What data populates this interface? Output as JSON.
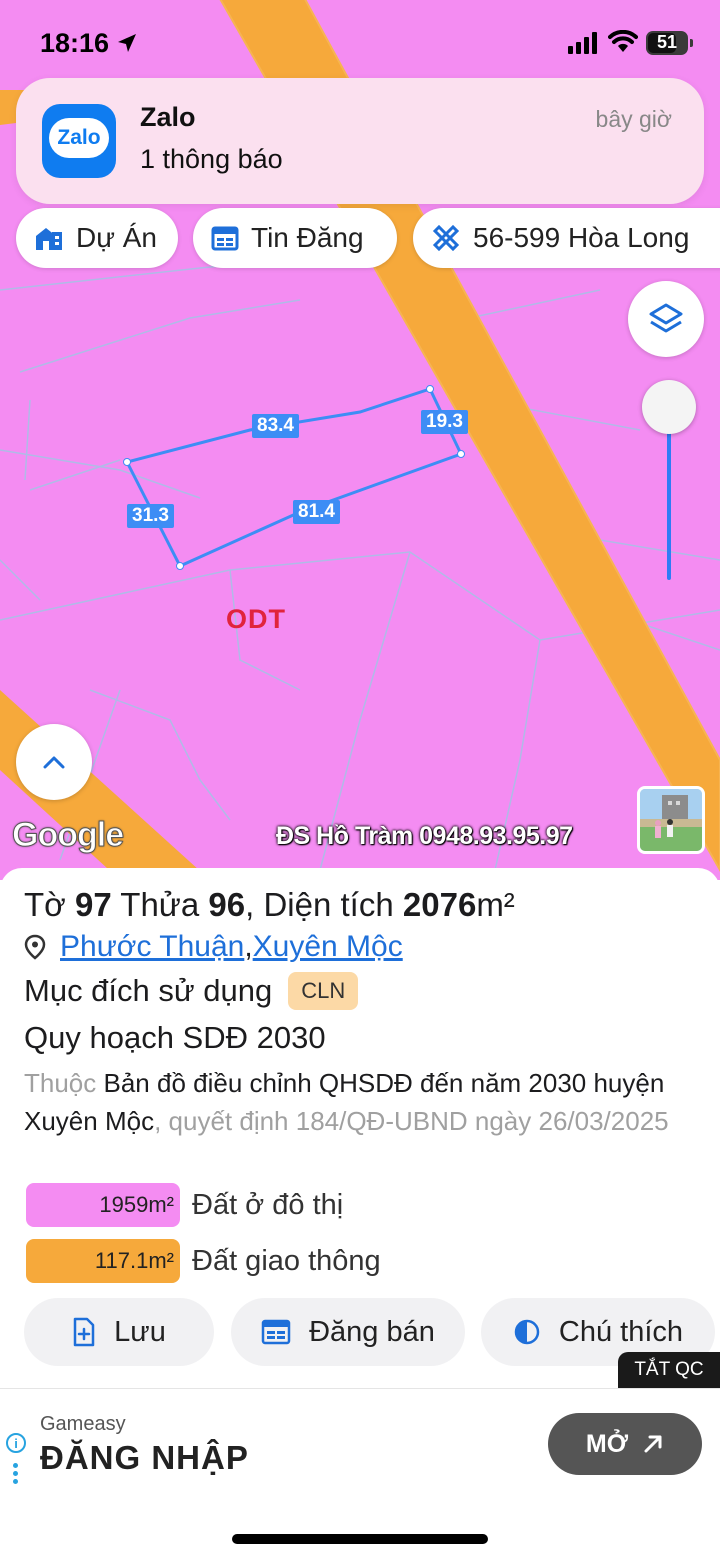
{
  "status_bar": {
    "time": "18:16",
    "battery": "51"
  },
  "notification": {
    "app_icon_text": "Zalo",
    "title": "Zalo",
    "body": "1 thông báo",
    "time": "bây giờ"
  },
  "chips": [
    {
      "label": "Dự Án",
      "icon": "building-icon"
    },
    {
      "label": "Tin Đăng",
      "icon": "listing-icon"
    },
    {
      "label": "56-599 Hòa Long",
      "icon": "ruler-pencil-icon"
    }
  ],
  "map": {
    "zone_label": "ODT",
    "dimensions": [
      "83.4",
      "19.3",
      "31.3",
      "81.4"
    ],
    "google_logo": "Google",
    "watermark": "ĐS Hồ Tràm 0948.93.95.97",
    "colors": {
      "land": "#f48cf2",
      "road": "#f6a93b",
      "outline": "#3d8df5"
    }
  },
  "panel": {
    "title_prefix": "Tờ",
    "sheet": "97",
    "parcel_label": "Thửa",
    "parcel": "96",
    "area_label": ", Diện tích",
    "area": "2076",
    "area_unit": "m²",
    "location_commune": "Phước Thuận",
    "location_separator": ", ",
    "location_district": "Xuyên Mộc",
    "purpose_label": "Mục đích sử dụng",
    "purpose_code": "CLN",
    "plan_title": "Quy hoạch SDĐ 2030",
    "desc_prefix": "Thuộc",
    "desc_main": "Bản đồ điều chỉnh QHSDĐ đến năm 2030 huyện Xuyên Mộc",
    "desc_decision": ", quyết định 184/QĐ-UBND ngày 26/03/2025",
    "legend": [
      {
        "value": "1959m²",
        "label": "Đất ở đô thị",
        "color": "#f48cf2"
      },
      {
        "value": "117.1m²",
        "label": "Đất giao thông",
        "color": "#f6a93b"
      }
    ],
    "actions": [
      {
        "label": "Lưu",
        "icon": "save-file-icon"
      },
      {
        "label": "Đăng bán",
        "icon": "post-listing-icon"
      },
      {
        "label": "Chú thích",
        "icon": "legend-contrast-icon"
      }
    ]
  },
  "ad": {
    "close_label": "TẮT QC",
    "brand": "Gameasy",
    "headline": "ĐĂNG NHẬP",
    "cta": "MỞ",
    "info": "i"
  }
}
